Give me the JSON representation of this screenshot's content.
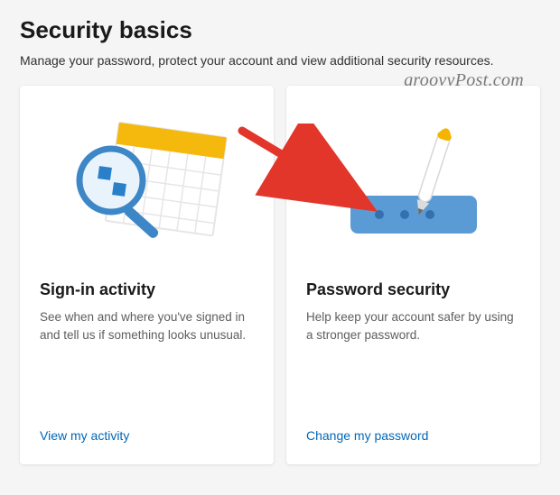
{
  "page": {
    "title": "Security basics",
    "subtitle": "Manage your password, protect your account and view additional security resources."
  },
  "watermark": "groovyPost.com",
  "cards": {
    "signin": {
      "title": "Sign-in activity",
      "desc": "See when and where you've signed in and tell us if something looks unusual.",
      "link": "View my activity"
    },
    "password": {
      "title": "Password security",
      "desc": "Help keep your account safer by using a stronger password.",
      "link": "Change my password"
    }
  }
}
